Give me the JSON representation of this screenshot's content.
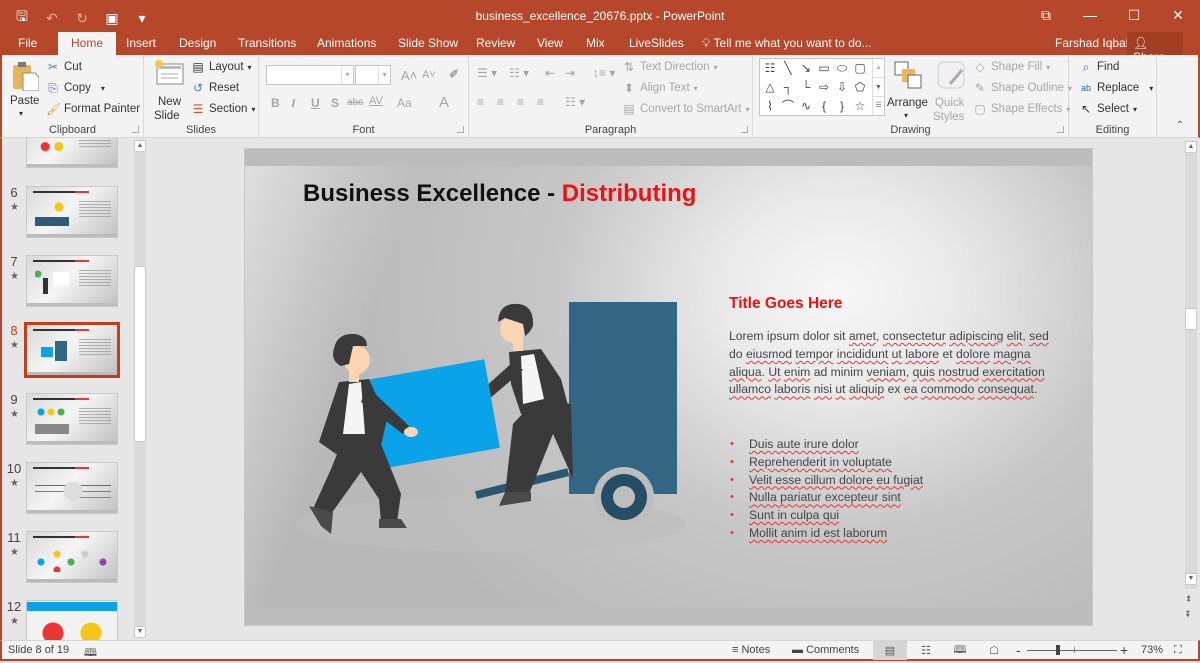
{
  "window": {
    "title": "business_excellence_20676.pptx - PowerPoint",
    "controls": {
      "restore_ribbon": "⧉",
      "minimize": "—",
      "maximize": "☐",
      "close": "✕"
    }
  },
  "qat": {
    "save": "🖫",
    "undo": "↶",
    "redo": "↻",
    "present": "▣",
    "customize": "▾"
  },
  "tabs": [
    "File",
    "Home",
    "Insert",
    "Design",
    "Transitions",
    "Animations",
    "Slide Show",
    "Review",
    "View",
    "Mix",
    "LiveSlides"
  ],
  "active_tab": "Home",
  "tell_me": "Tell me what you want to do...",
  "user_name": "Farshad Iqbal",
  "share_label": "Share",
  "ribbon": {
    "clipboard": {
      "label": "Clipboard",
      "paste": "Paste",
      "cut": "Cut",
      "copy": "Copy",
      "format_painter": "Format Painter"
    },
    "slides": {
      "label": "Slides",
      "new_slide_1": "New",
      "new_slide_2": "Slide",
      "layout": "Layout",
      "reset": "Reset",
      "section": "Section"
    },
    "font": {
      "label": "Font",
      "font_name": "",
      "font_size": "",
      "bold": "B",
      "italic": "I",
      "underline": "U",
      "shadow": "S",
      "strike": "abc",
      "spacing": "AV",
      "case": "Aa",
      "color": "A",
      "grow": "A˄",
      "shrink": "A˅"
    },
    "paragraph": {
      "label": "Paragraph",
      "text_direction": "Text Direction",
      "align_text": "Align Text",
      "convert_smartart": "Convert to SmartArt"
    },
    "drawing": {
      "label": "Drawing",
      "arrange": "Arrange",
      "quick_styles_1": "Quick",
      "quick_styles_2": "Styles",
      "shape_fill": "Shape Fill",
      "shape_outline": "Shape Outline",
      "shape_effects": "Shape Effects",
      "shapes": [
        "☷",
        "╲",
        "↘",
        "▭",
        "⬭",
        "▢",
        "△",
        "┐",
        "└",
        "⇨",
        "⇩",
        "⬠",
        "⌇",
        "⌒",
        "∿",
        "{",
        "}",
        "☆"
      ]
    },
    "editing": {
      "label": "Editing",
      "find": "Find",
      "replace": "Replace",
      "select": "Select"
    }
  },
  "slides_panel": {
    "thumbnails": [
      {
        "number": "6",
        "accent": "#f5c518"
      },
      {
        "number": "7",
        "accent": "#4caf50"
      },
      {
        "number": "8",
        "accent": "#0aa2e8",
        "selected": true
      },
      {
        "number": "9",
        "accent": "#0aa2e8"
      },
      {
        "number": "10",
        "accent": "#e33b3b"
      },
      {
        "number": "11",
        "accent": "#f5c518"
      },
      {
        "number": "12",
        "accent": "#0aa2e8"
      }
    ],
    "star": "★"
  },
  "slide": {
    "title_main": "Business Excellence - ",
    "title_accent": "Distributing",
    "subtitle": "Title Goes Here",
    "paragraph_words": [
      [
        "Lorem ipsum dolor sit ",
        false
      ],
      [
        "amet",
        true
      ],
      [
        ", ",
        false
      ],
      [
        "consectetur",
        true
      ],
      [
        " ",
        false
      ],
      [
        "adipiscing",
        true
      ],
      [
        " ",
        false
      ],
      [
        "elit",
        true
      ],
      [
        ", ",
        false
      ],
      [
        "sed",
        true
      ],
      [
        " do ",
        false
      ],
      [
        "eiusmod",
        true
      ],
      [
        " ",
        false
      ],
      [
        "tempor",
        true
      ],
      [
        " ",
        false
      ],
      [
        "incididunt",
        true
      ],
      [
        " ",
        false
      ],
      [
        "ut",
        true
      ],
      [
        " ",
        false
      ],
      [
        "labore",
        true
      ],
      [
        " et ",
        false
      ],
      [
        "dolore",
        true
      ],
      [
        " ",
        false
      ],
      [
        "magna",
        true
      ],
      [
        " ",
        false
      ],
      [
        "aliqua",
        true
      ],
      [
        ". ",
        false
      ],
      [
        "Ut",
        true
      ],
      [
        " ",
        false
      ],
      [
        "enim",
        true
      ],
      [
        " ad minim ",
        false
      ],
      [
        "veniam",
        true
      ],
      [
        ", ",
        false
      ],
      [
        "quis",
        true
      ],
      [
        " ",
        false
      ],
      [
        "nostrud",
        true
      ],
      [
        " ",
        false
      ],
      [
        "exercitation",
        true
      ],
      [
        " ",
        false
      ],
      [
        "ullamco",
        true
      ],
      [
        " ",
        false
      ],
      [
        "laboris",
        true
      ],
      [
        " ",
        false
      ],
      [
        "nisi",
        true
      ],
      [
        " ",
        false
      ],
      [
        "ut",
        true
      ],
      [
        " ",
        false
      ],
      [
        "aliquip",
        true
      ],
      [
        " ex ",
        false
      ],
      [
        "ea",
        true
      ],
      [
        " ",
        false
      ],
      [
        "commodo",
        true
      ],
      [
        " ",
        false
      ],
      [
        "consequat",
        true
      ],
      [
        ".",
        false
      ]
    ],
    "bullets": [
      "Duis aute irure dolor",
      "Reprehenderit in voluptate",
      "Velit esse cillum dolore eu fugiat",
      "Nulla pariatur excepteur sint",
      "Sunt in culpa qui",
      "Mollit anim id est laborum"
    ],
    "colors": {
      "box": "#0aa2e8",
      "truck": "#336683",
      "suit": "#3a3a3a",
      "skin": "#fbd4b4"
    }
  },
  "statusbar": {
    "slide_indicator": "Slide 8 of 19",
    "notes": "Notes",
    "comments": "Comments",
    "zoom_out": "-",
    "zoom_in": "+",
    "zoom_level": "73%"
  }
}
